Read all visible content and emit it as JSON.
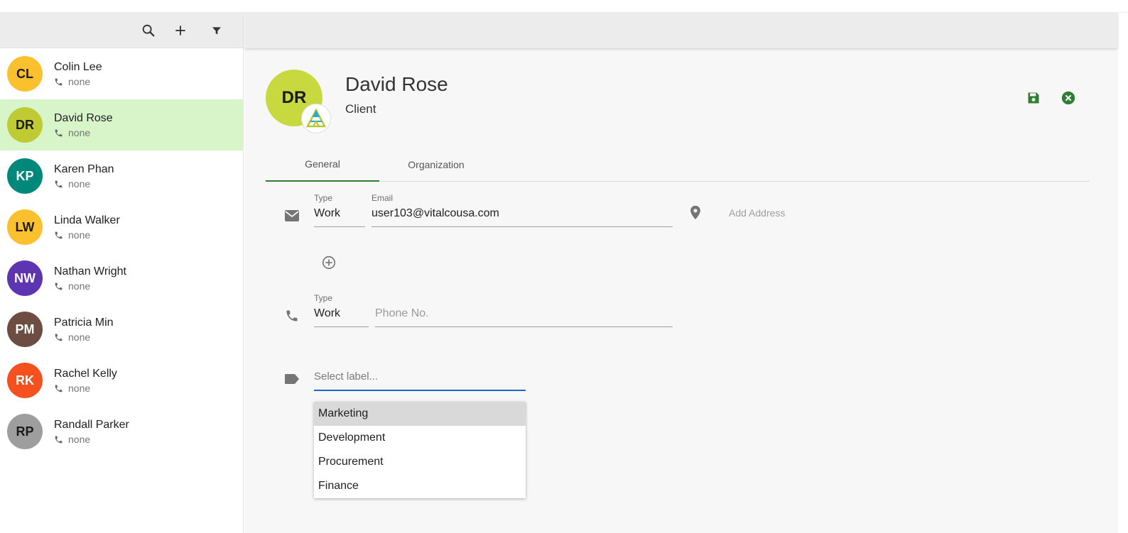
{
  "sidebar": {
    "toolbar": {
      "search_icon": "search-icon",
      "add_icon": "plus-icon",
      "filter_icon": "filter-icon"
    },
    "contacts": [
      {
        "initials": "CL",
        "name": "Colin Lee",
        "phone": "none",
        "color": "#fbc02d"
      },
      {
        "initials": "DR",
        "name": "David Rose",
        "phone": "none",
        "color": "#c0ca33"
      },
      {
        "initials": "KP",
        "name": "Karen Phan",
        "phone": "none",
        "color": "#00897b"
      },
      {
        "initials": "LW",
        "name": "Linda Walker",
        "phone": "none",
        "color": "#fbc02d"
      },
      {
        "initials": "NW",
        "name": "Nathan Wright",
        "phone": "none",
        "color": "#5e35b1"
      },
      {
        "initials": "PM",
        "name": "Patricia Min",
        "phone": "none",
        "color": "#6d4c41"
      },
      {
        "initials": "RK",
        "name": "Rachel Kelly",
        "phone": "none",
        "color": "#f4511e"
      },
      {
        "initials": "RP",
        "name": "Randall Parker",
        "phone": "none",
        "color": "#9e9e9e"
      }
    ],
    "selected_color": "#d7f5c9"
  },
  "detail": {
    "initials": "DR",
    "name": "David Rose",
    "role": "Client",
    "avatar_color": "#c8d940",
    "accent": "#2e7d32",
    "tabs": [
      {
        "label": "General"
      },
      {
        "label": "Organization"
      }
    ],
    "email": {
      "type_label": "Type",
      "type_value": "Work",
      "email_label": "Email",
      "email_value": "user103@vitalcousa.com"
    },
    "add_address": "Add Address",
    "phone": {
      "type_label": "Type",
      "type_value": "Work",
      "placeholder": "Phone No."
    },
    "label_select": {
      "placeholder": "Select label...",
      "options": [
        "Marketing",
        "Development",
        "Procurement",
        "Finance"
      ]
    }
  }
}
